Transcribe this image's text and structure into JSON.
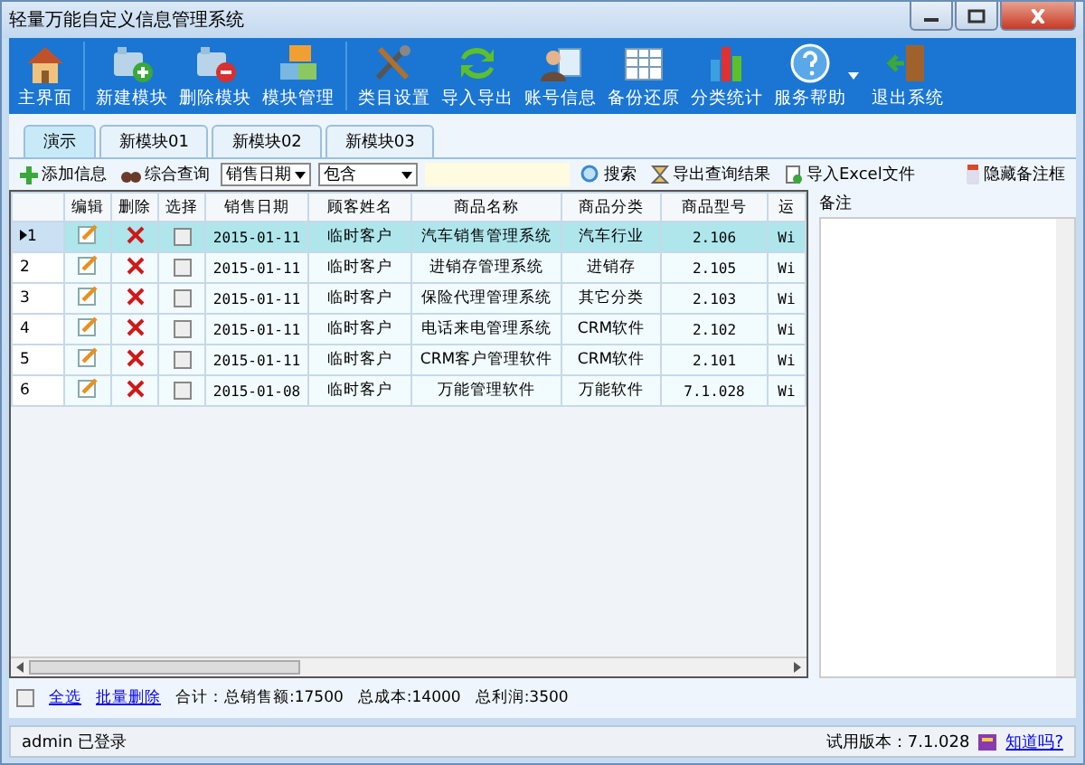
{
  "window": {
    "title": "轻量万能自定义信息管理系统"
  },
  "toolbar": [
    {
      "label": "主界面"
    },
    {
      "label": "新建模块"
    },
    {
      "label": "删除模块"
    },
    {
      "label": "模块管理"
    },
    {
      "label": "类目设置"
    },
    {
      "label": "导入导出"
    },
    {
      "label": "账号信息"
    },
    {
      "label": "备份还原"
    },
    {
      "label": "分类统计"
    },
    {
      "label": "服务帮助"
    },
    {
      "label": "退出系统"
    }
  ],
  "tabs": [
    {
      "label": "演示",
      "selected": true
    },
    {
      "label": "新模块01",
      "selected": false
    },
    {
      "label": "新模块02",
      "selected": false
    },
    {
      "label": "新模块03",
      "selected": false
    }
  ],
  "query_bar": {
    "add": "添加信息",
    "combined": "综合查询",
    "field": "销售日期",
    "operator": "包含",
    "search": "搜索",
    "export": "导出查询结果",
    "import": "导入Excel文件",
    "hide_notes": "隐藏备注框"
  },
  "table": {
    "action_columns": [
      "编辑",
      "删除",
      "选择"
    ],
    "columns": [
      "销售日期",
      "顾客姓名",
      "商品名称",
      "商品分类",
      "商品型号",
      "运"
    ],
    "rows": [
      {
        "number": "1",
        "selected": true,
        "checked": false,
        "cells": [
          "2015-01-11",
          "临时客户",
          "汽车销售管理系统",
          "汽车行业",
          "2.106",
          "Wi"
        ]
      },
      {
        "number": "2",
        "selected": false,
        "checked": false,
        "cells": [
          "2015-01-11",
          "临时客户",
          "进销存管理系统",
          "进销存",
          "2.105",
          "Wi"
        ]
      },
      {
        "number": "3",
        "selected": false,
        "checked": false,
        "cells": [
          "2015-01-11",
          "临时客户",
          "保险代理管理系统",
          "其它分类",
          "2.103",
          "Wi"
        ]
      },
      {
        "number": "4",
        "selected": false,
        "checked": false,
        "cells": [
          "2015-01-11",
          "临时客户",
          "电话来电管理系统",
          "CRM软件",
          "2.102",
          "Wi"
        ]
      },
      {
        "number": "5",
        "selected": false,
        "checked": false,
        "cells": [
          "2015-01-11",
          "临时客户",
          "CRM客户管理软件",
          "CRM软件",
          "2.101",
          "Wi"
        ]
      },
      {
        "number": "6",
        "selected": false,
        "checked": false,
        "cells": [
          "2015-01-08",
          "临时客户",
          "万能管理软件",
          "万能软件",
          "7.1.028",
          "Wi"
        ]
      }
    ]
  },
  "notes": {
    "label": "备注"
  },
  "summary": {
    "select_all": "全选",
    "select_all_checked": false,
    "batch_delete": "批量删除",
    "totals": "合计：总销售额:17500",
    "cost": "总成本:14000",
    "profit": "总利润:3500"
  },
  "status_bar": {
    "user": "admin 已登录",
    "version": "试用版本：7.1.028",
    "link": "知道吗?"
  }
}
